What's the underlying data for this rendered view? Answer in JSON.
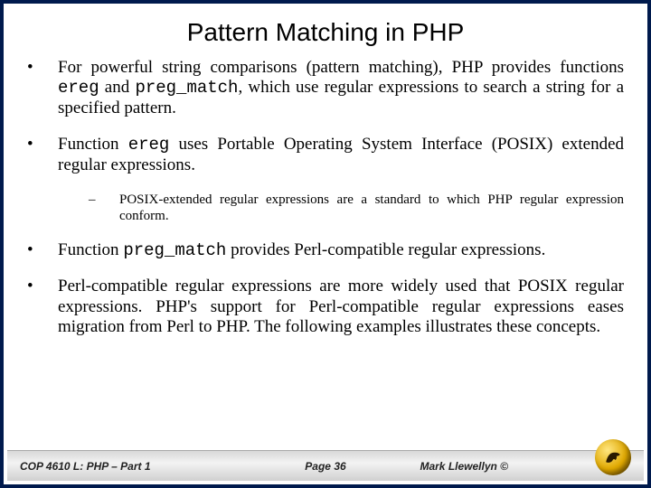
{
  "title": "Pattern Matching in PHP",
  "bullets": {
    "b1_a": "For powerful string comparisons (pattern matching), PHP provides functions ",
    "b1_code1": "ereg",
    "b1_b": " and ",
    "b1_code2": "preg_match",
    "b1_c": ", which use regular expressions to search a string for a specified pattern.",
    "b2_a": "Function ",
    "b2_code": "ereg",
    "b2_b": " uses Portable Operating System Interface (POSIX) extended regular expressions.",
    "sub1": "POSIX-extended regular expressions are a standard to which PHP regular expression conform.",
    "b3_a": "Function ",
    "b3_code": "preg_match",
    "b3_b": " provides Perl-compatible regular expressions.",
    "b4": "Perl-compatible regular expressions are more widely used that POSIX regular expressions.  PHP's support for Perl-compatible regular expressions eases migration from Perl to PHP.  The following examples illustrates these concepts."
  },
  "footer": {
    "left": "COP 4610 L: PHP – Part 1",
    "center": "Page 36",
    "right": "Mark Llewellyn ©"
  }
}
